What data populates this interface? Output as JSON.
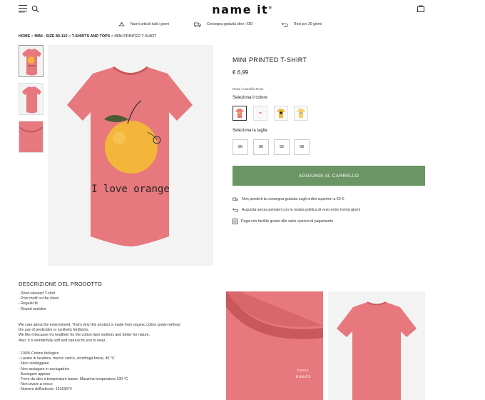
{
  "header": {
    "menu_label": "MENU",
    "logo": "name it",
    "logo_mark": "®"
  },
  "usp": [
    {
      "text": "Nuovi articoli tutti i giorni",
      "icon": "hanger-icon"
    },
    {
      "text": "Consegna gratuita oltre i €50",
      "icon": "truck-icon"
    },
    {
      "text": "Resi per 30 giorni",
      "icon": "return-icon"
    }
  ],
  "breadcrumb": {
    "items": [
      "HOME",
      "MINI - SIZE 80-110",
      "T-SHIRTS AND TOPS"
    ],
    "current": "MINI PRINTED T-SHIRT",
    "separator": " > "
  },
  "product": {
    "title": "MINI PRINTED T-SHIRT",
    "price": "€ 6,99",
    "color_name": "Rosa / Camellia Rose",
    "color_label": "Seleziona il colore",
    "size_label": "Seleziona la taglia",
    "sizes": [
      "80",
      "86",
      "92",
      "98"
    ],
    "print_text": "I love orange",
    "cart_button": "AGGIUNGI AL CARRELLO",
    "info": [
      "Non perderti la consegna gratuita sugli ordini superiori a 60 €.",
      "Acquista senza pensieri con la nostra politica di reso entro trenta giorni",
      "Paga con facilità grazie alle varie opzioni di pagamento"
    ]
  },
  "description": {
    "title": "DESCRIZIONE DEL PRODOTTO",
    "features": [
      "- Short-sleeved T-shirt",
      "- Print motif on the chest",
      "- Regular fit",
      "- Round neckline"
    ],
    "paragraph": [
      "We care about the environment. That's why this product is made from organic cotton grown without",
      "the use of pesticides or synthetic fertilizers.",
      "We like it because it's healthier for the cotton farm workers and better for nature.",
      "Also, it is wonderfully soft and natural for you to wear."
    ],
    "care": [
      "- 100% Cotone biologico",
      "- Lavare in lavatrice, mezzo carico, centrifuga breve, 40 °C",
      "- Non candeggiare",
      "- Non asciugare in asciugatrice",
      "- Asciugare appeso",
      "- Ferro da stiro a temperature basse. Massima temperatura 100 °C",
      "- Non lavare a secco",
      "- Numero dell'articolo: 13163674"
    ]
  },
  "detail_photo_label": [
    "basic",
    "needs"
  ],
  "colors": {
    "accent_green": "#6c9565",
    "shirt_pink": "#e7787d",
    "orange": "#f3b53a"
  }
}
